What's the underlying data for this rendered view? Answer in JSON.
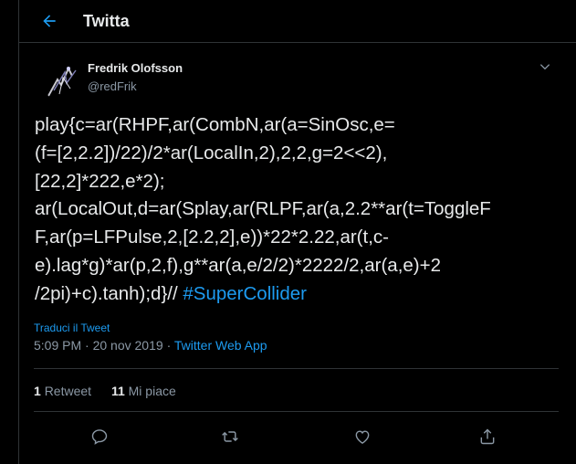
{
  "header": {
    "title": "Twitta",
    "back_icon": "arrow-left-icon"
  },
  "tweet": {
    "author": {
      "name": "Fredrik Olofsson",
      "handle": "@redFrik"
    },
    "text_lines": [
      "play{c=ar(RHPF,ar(CombN,ar(a=SinOsc,e=",
      "(f=[2,2.2])/22)/2*ar(LocalIn,2),2,2,g=2<<2),",
      "[22,2]*222,e*2);",
      "ar(LocalOut,d=ar(Splay,ar(RLPF,ar(a,2.2**ar(t=ToggleF",
      "F,ar(p=LFPulse,2,[2.2,2],e))*22*2.22,ar(t,c-",
      "e).lag*g)*ar(p,2,f),g**ar(a,e/2/2)*2222/2,ar(a,e)+2",
      "/2pi)+c).tanh);d}// "
    ],
    "hashtag": "#SuperCollider",
    "translate_label": "Traduci il Tweet",
    "time": "5:09 PM",
    "date": "20 nov 2019",
    "separator": "·",
    "source": "Twitter Web App",
    "stats": {
      "retweets_count": "1",
      "retweets_label": "Retweet",
      "likes_count": "11",
      "likes_label": "Mi piace"
    }
  },
  "colors": {
    "background": "#000000",
    "accent": "#1d9bf0",
    "muted": "#8b98a5",
    "border": "#2f3336"
  },
  "icons": [
    "arrow-left-icon",
    "chevron-down-icon",
    "reply-icon",
    "retweet-icon",
    "like-icon",
    "share-icon"
  ]
}
